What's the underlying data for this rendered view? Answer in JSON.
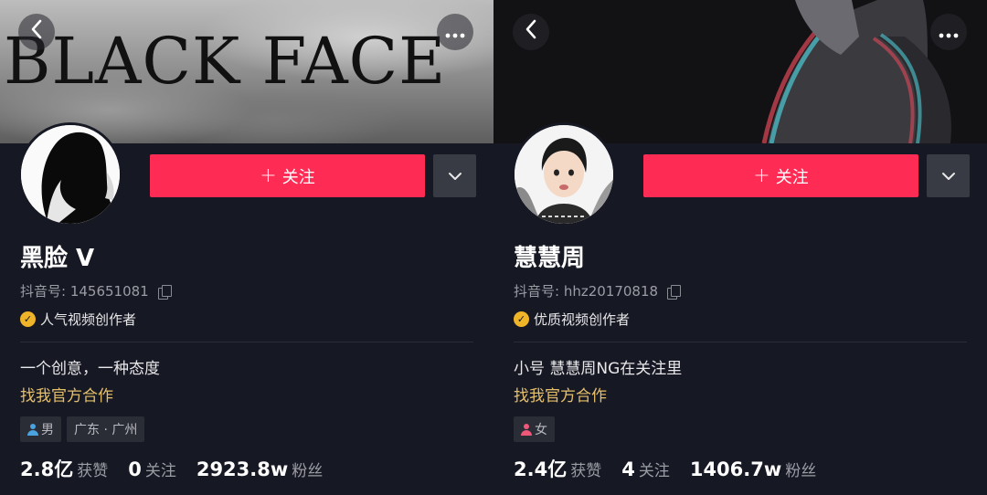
{
  "profiles": [
    {
      "banner_text": "BLACK  FACE",
      "follow_label": "关注",
      "plus": "+",
      "nickname": "黑脸 V",
      "account_label": "抖音号: 145651081",
      "creator_badge": "人气视频创作者",
      "bio": "一个创意，一种态度",
      "cooperation": "找我官方合作",
      "tags": {
        "gender": "男",
        "location": "广东 · 广州"
      },
      "stats": [
        {
          "num": "2.8亿",
          "label": "获赞"
        },
        {
          "num": "0",
          "label": "关注"
        },
        {
          "num": "2923.8w",
          "label": "粉丝"
        }
      ]
    },
    {
      "follow_label": "关注",
      "plus": "+",
      "nickname": "慧慧周",
      "account_label": "抖音号: hhz20170818",
      "creator_badge": "优质视频创作者",
      "bio": "小号 慧慧周NG在关注里",
      "cooperation": "找我官方合作",
      "tags": {
        "gender": "女"
      },
      "stats": [
        {
          "num": "2.4亿",
          "label": "获赞"
        },
        {
          "num": "4",
          "label": "关注"
        },
        {
          "num": "1406.7w",
          "label": "粉丝"
        }
      ]
    }
  ],
  "icons": {
    "back": "chevron-left-icon",
    "more": "more-dots-icon",
    "dropdown": "chevron-down-icon",
    "copy": "copy-icon",
    "verify": "verified-badge-icon"
  },
  "colors": {
    "background": "#161823",
    "follow_button": "#fe2c55",
    "cooperation_text": "#e5c06b",
    "verify_badge": "#f0b429"
  }
}
